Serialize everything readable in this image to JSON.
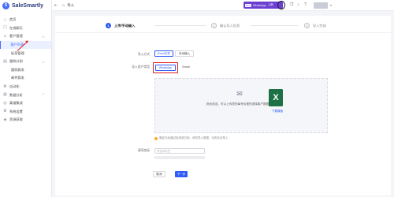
{
  "app": {
    "brand": "SaleSmartly",
    "logo_letter": "S"
  },
  "sidebar": {
    "items": [
      {
        "label": "首页",
        "icon": "home-icon",
        "glyph": "⌂"
      },
      {
        "label": "在线聊天",
        "icon": "chat-icon",
        "glyph": "☐"
      },
      {
        "label": "客户管理",
        "icon": "users-icon",
        "glyph": "☺",
        "expanded": true
      },
      {
        "label": "客户列表",
        "sub": true,
        "active": true
      },
      {
        "label": "标签管理",
        "sub": true
      },
      {
        "label": "跟踪计划",
        "icon": "plan-icon",
        "glyph": "▤",
        "expanded": true
      },
      {
        "label": "跟踪群发",
        "sub": true
      },
      {
        "label": "邮件群发",
        "sub": true
      },
      {
        "label": "自动化",
        "icon": "automation-icon",
        "glyph": "⚙"
      },
      {
        "label": "数据分析",
        "icon": "chart-icon",
        "glyph": "▥"
      },
      {
        "label": "渠道集成",
        "icon": "channel-icon",
        "glyph": "◎"
      },
      {
        "label": "系统设置",
        "icon": "settings-icon",
        "glyph": "⚙"
      },
      {
        "label": "资源获取",
        "icon": "resource-icon",
        "glyph": "◈"
      }
    ]
  },
  "header": {
    "title": "导入",
    "wa_new": "New",
    "wa_label": "WhatsApp",
    "wa_suffix": "上新"
  },
  "steps": [
    {
      "num": "1",
      "label": "上传/手动输入",
      "active": true
    },
    {
      "num": "2",
      "label": "确认导入信息",
      "active": false
    },
    {
      "num": "3",
      "label": "导入完成",
      "active": false
    }
  ],
  "form": {
    "method_label": "导入方式",
    "method_options": [
      "Excel文件",
      "手动输入"
    ],
    "type_label": "导入用户类型",
    "type_options": [
      "WhatsApp",
      "Email"
    ],
    "upload_hint": "拖出到这，可以上传您的每号合规的选择客户数据表文件",
    "template_link": "下载模板",
    "tip": "确定已经通过检测或已知，请勿导入数据，无则无法导入",
    "tag_label": "请添加标",
    "tag_placeholder": "请选择标签",
    "back_button": "取消",
    "next_button": "下一步"
  },
  "colors": {
    "accent": "#2d5cf6",
    "highlight": "#e02020",
    "wa_badge": "#6a3fd1",
    "excel": "#1e7145"
  }
}
